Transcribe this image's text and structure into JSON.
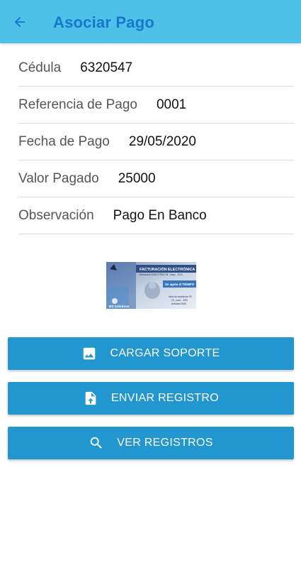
{
  "appbar": {
    "back_icon": "arrow-left-icon",
    "title": "Asociar Pago",
    "color": "#4dc1e8",
    "title_color": "#1976c9"
  },
  "form": {
    "rows": [
      {
        "label": "Cédula",
        "value": "6320547"
      },
      {
        "label": "Referencia de Pago",
        "value": "0001"
      },
      {
        "label": "Fecha de Pago",
        "value": "29/05/2020"
      },
      {
        "label": "Valor Pagado",
        "value": "25000"
      },
      {
        "label": "Observación",
        "value": "Pago En Banco"
      }
    ]
  },
  "banner": {
    "headline": "FACTURACIÓN ELECTRÓNICA",
    "subline": "Resolución DIAN N°0042 05 - Mayo - 2020",
    "tagline": "Se agota el TIEMPO",
    "note_lines": [
      "Inicio de expedición FE",
      "15 - junio - 2020",
      "Actividad 9025"
    ],
    "brand": "BS Solutions"
  },
  "buttons": {
    "upload": {
      "label": "CARGAR SOPORTE",
      "icon": "image-icon"
    },
    "send": {
      "label": "ENVIAR REGISTRO",
      "icon": "file-upload-icon"
    },
    "view": {
      "label": "VER REGISTROS",
      "icon": "search-icon"
    },
    "color": "#2196cf"
  }
}
